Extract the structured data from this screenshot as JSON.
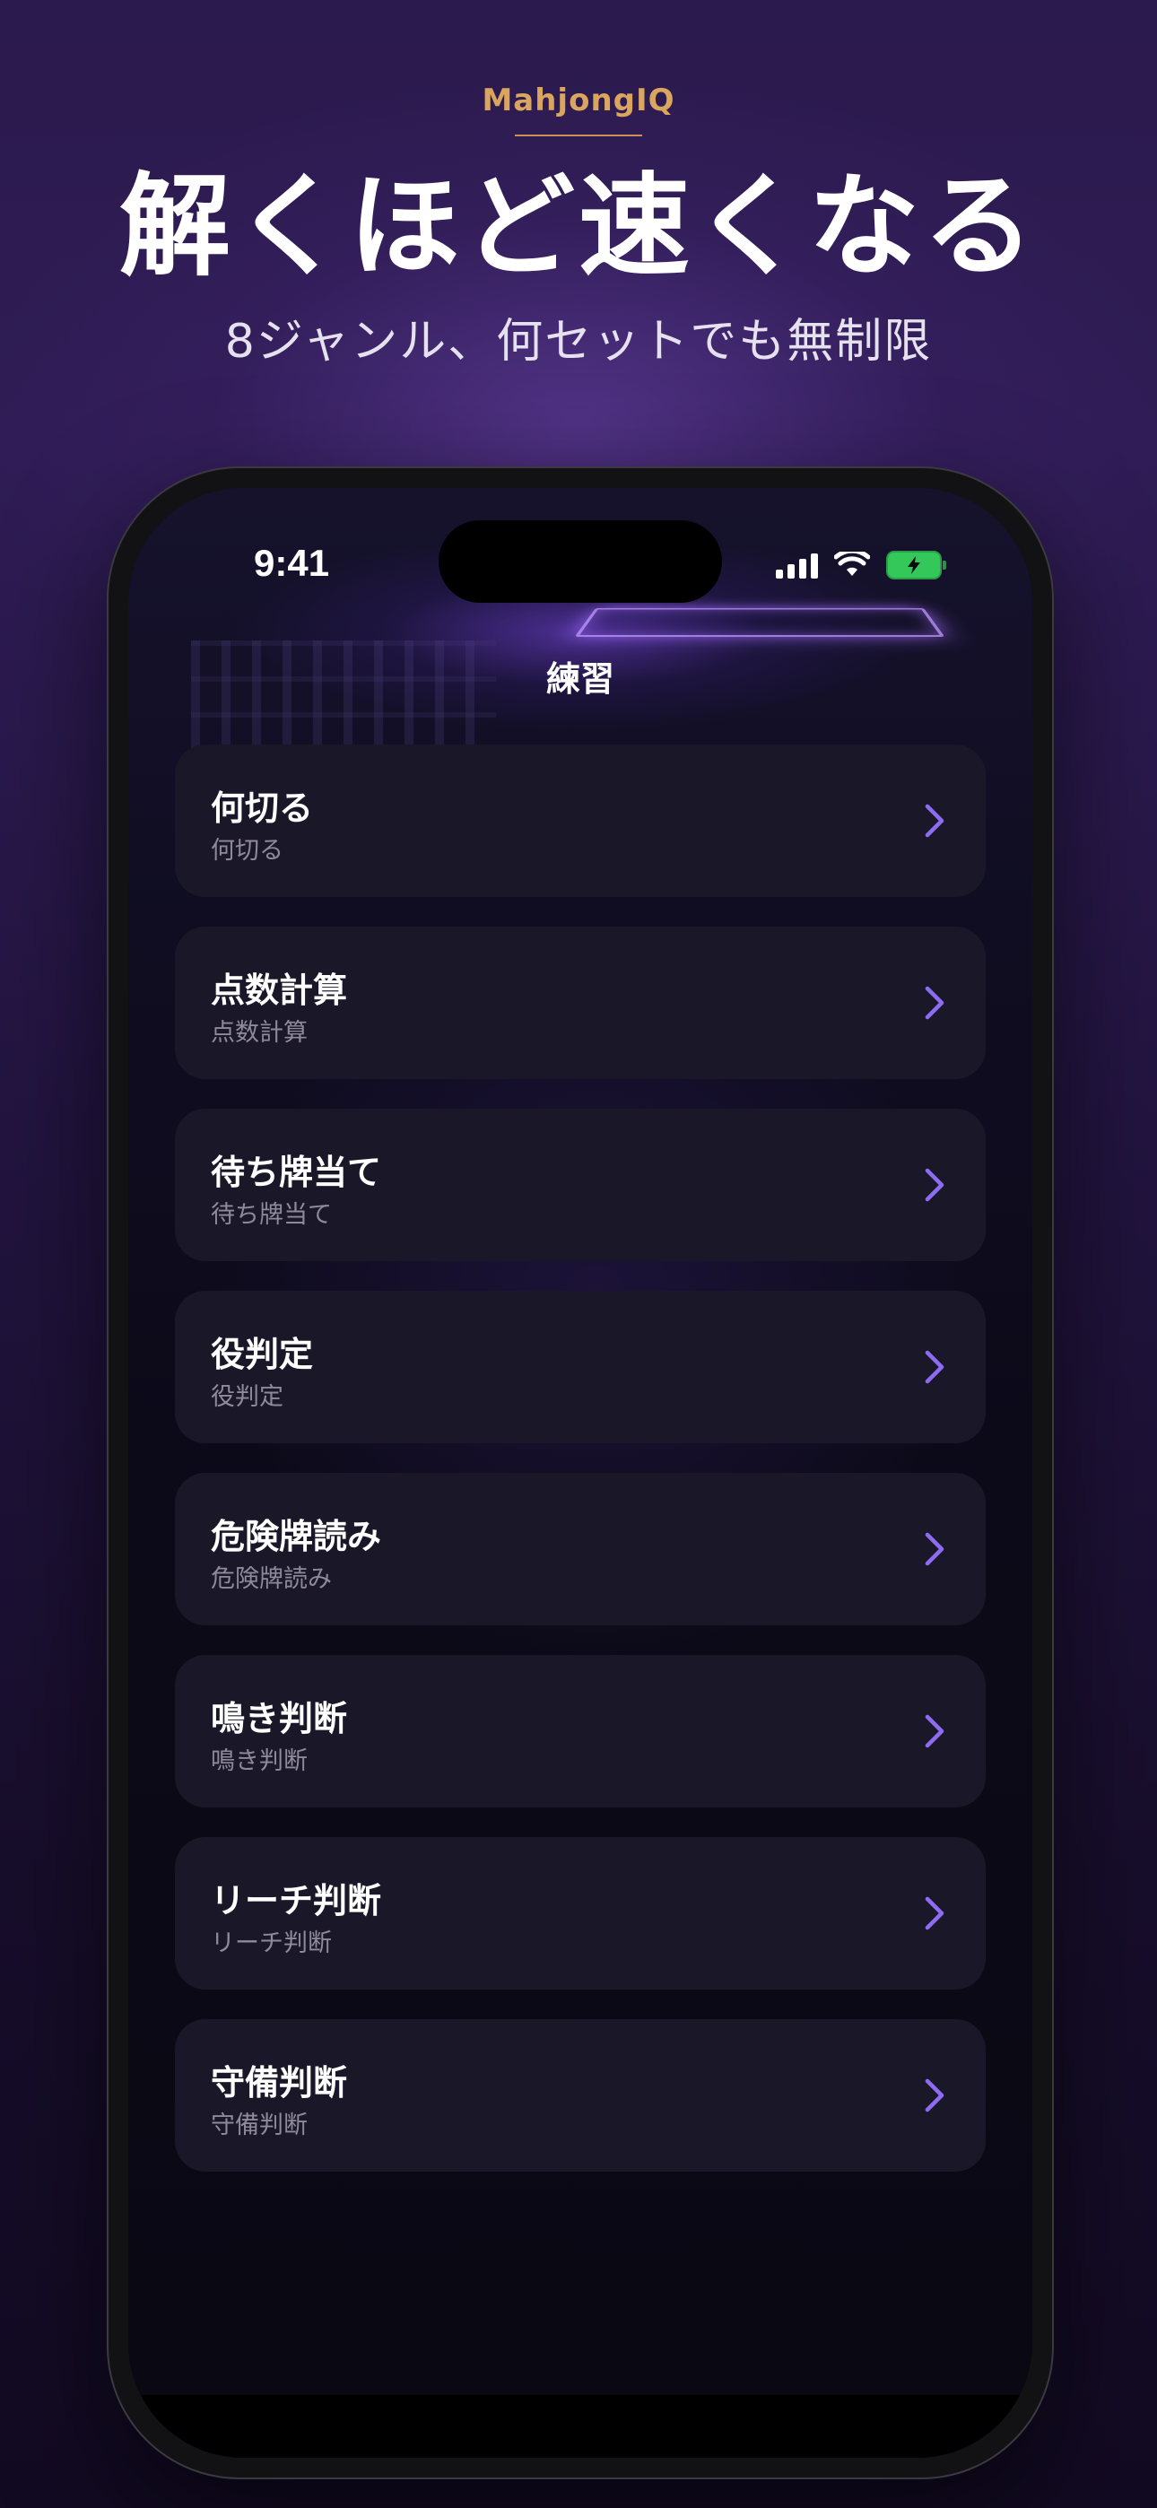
{
  "marketing": {
    "brand": "MahjongIQ",
    "headline": "解くほど速くなる",
    "subhead": "8ジャンル、何セットでも無制限"
  },
  "status_bar": {
    "time": "9:41",
    "icons": [
      "cellular-signal-icon",
      "wifi-icon",
      "battery-charging-icon"
    ]
  },
  "nav": {
    "title": "練習"
  },
  "practice_items": [
    {
      "title": "何切る",
      "subtitle": "何切る"
    },
    {
      "title": "点数計算",
      "subtitle": "点数計算"
    },
    {
      "title": "待ち牌当て",
      "subtitle": "待ち牌当て"
    },
    {
      "title": "役判定",
      "subtitle": "役判定"
    },
    {
      "title": "危険牌読み",
      "subtitle": "危険牌読み"
    },
    {
      "title": "鳴き判断",
      "subtitle": "鳴き判断"
    },
    {
      "title": "リーチ判断",
      "subtitle": "リーチ判断"
    },
    {
      "title": "守備判断",
      "subtitle": "守備判断"
    }
  ],
  "colors": {
    "brand_gold": "#d9a55f",
    "accent_purple": "#8b6cf2",
    "card_bg": "#1a1828",
    "battery_green": "#34c759"
  }
}
